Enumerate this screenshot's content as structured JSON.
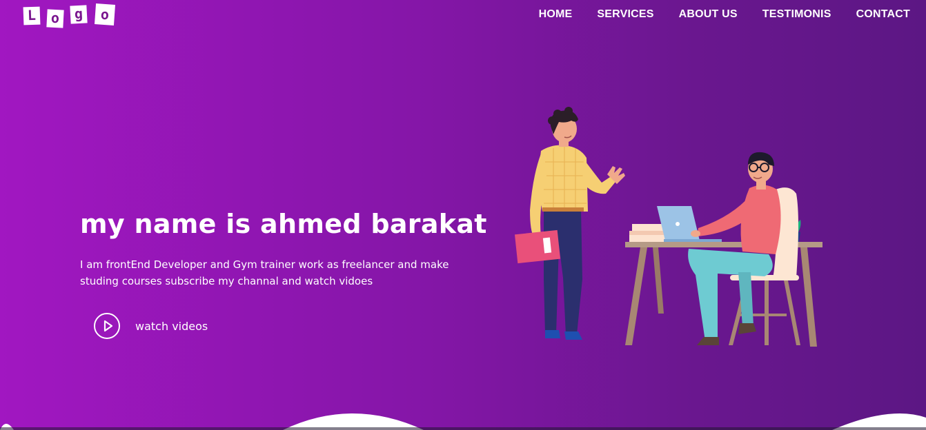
{
  "logo": {
    "letters": [
      "L",
      "o",
      "g",
      "o"
    ]
  },
  "nav": {
    "items": [
      "HOME",
      "SERVICES",
      "ABOUT US",
      "TESTIMONIS",
      "CONTACT"
    ]
  },
  "hero": {
    "title": "my name is ahmed barakat",
    "description": "I am frontEnd Developer and Gym trainer work as freelancer and make studing courses subscribe my channal and watch vidoes",
    "cta_label": "watch videos",
    "cta_icon": "play-icon"
  },
  "colors": {
    "gradient_start": "#a117c1",
    "gradient_end": "#5c1784",
    "text": "#ffffff"
  }
}
